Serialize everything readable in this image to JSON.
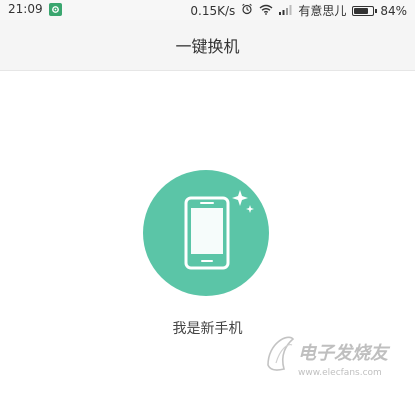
{
  "status_bar": {
    "time": "21:09",
    "network_speed": "0.15K/s",
    "carrier": "有意思儿",
    "battery_percent_text": "84%",
    "battery_level": 0.84,
    "icons": [
      "app-notification-icon",
      "alarm-clock-icon",
      "wifi-icon",
      "signal-icon",
      "battery-icon"
    ]
  },
  "title_bar": {
    "title": "一键换机"
  },
  "main": {
    "new_phone_label": "我是新手机"
  },
  "watermark": {
    "brand_text": "电子发烧友",
    "url_text": "www.elecfans.com"
  },
  "colors": {
    "accent": "#5bc5a7",
    "status_bar_bg": "#f7f7f7",
    "title_bar_bg": "#f5f5f5"
  }
}
